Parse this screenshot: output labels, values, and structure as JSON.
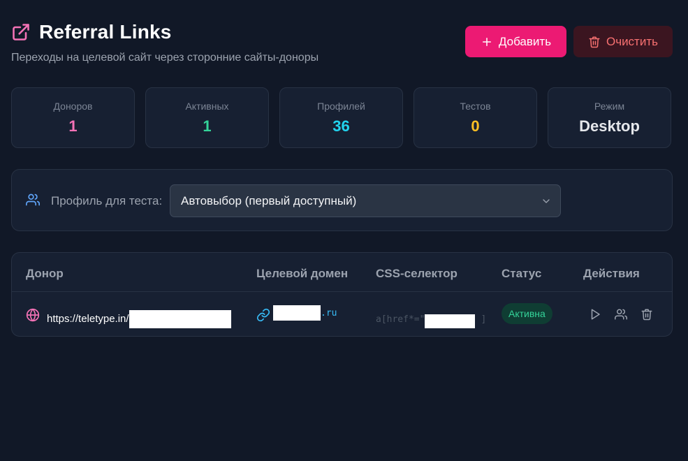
{
  "header": {
    "title": "Referral Links",
    "subtitle": "Переходы на целевой сайт через сторонние сайты-доноры",
    "title_icon": "external-link-icon"
  },
  "actions": {
    "add_label": "Добавить",
    "clear_label": "Очистить"
  },
  "stats": [
    {
      "label": "Доноров",
      "value": "1",
      "color": "#f472b6"
    },
    {
      "label": "Активных",
      "value": "1",
      "color": "#34d399"
    },
    {
      "label": "Профилей",
      "value": "36",
      "color": "#22d3ee"
    },
    {
      "label": "Тестов",
      "value": "0",
      "color": "#fbbf24"
    },
    {
      "label": "Режим",
      "value": "Desktop",
      "color": "#e5e7eb"
    }
  ],
  "profile_select": {
    "label": "Профиль для теста:",
    "selected": "Автовыбор (первый доступный)"
  },
  "table": {
    "columns": [
      "Донор",
      "Целевой домен",
      "CSS-селектор",
      "Статус",
      "Действия"
    ],
    "rows": [
      {
        "donor": "https://teletype.in/",
        "target_domain": ".ru",
        "css_selector_prefix": "a[href*=\"",
        "css_selector_suffix": "]",
        "status": "Активна"
      }
    ]
  },
  "colors": {
    "accent": "#ec1a73",
    "danger_bg": "#3b1520",
    "danger_text": "#f87171",
    "status_active": "#34d399"
  }
}
